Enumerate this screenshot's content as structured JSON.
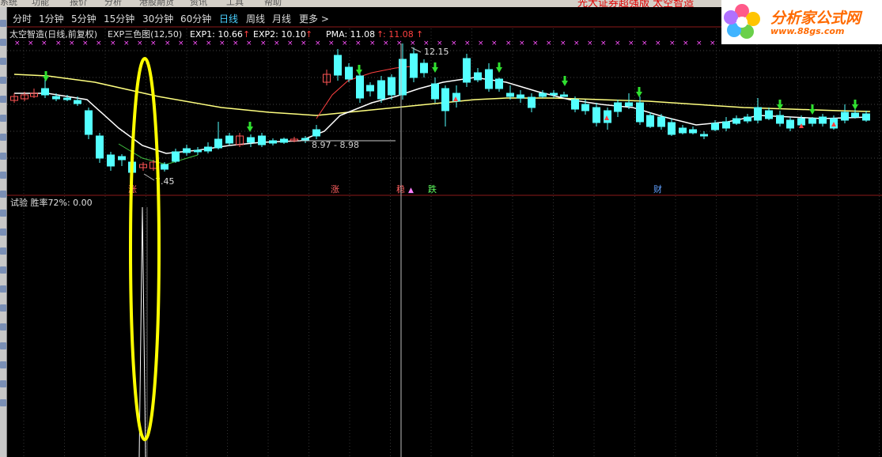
{
  "menu": {
    "items": [
      "系统",
      "功能",
      "报价",
      "分析",
      "港股期货",
      "资讯",
      "工具",
      "帮助"
    ],
    "title_red": "光大证券超强版  太空智造"
  },
  "periods": [
    {
      "label": "分时",
      "active": false
    },
    {
      "label": "1分钟",
      "active": false
    },
    {
      "label": "5分钟",
      "active": false
    },
    {
      "label": "15分钟",
      "active": false
    },
    {
      "label": "30分钟",
      "active": false
    },
    {
      "label": "60分钟",
      "active": false
    },
    {
      "label": "日线",
      "active": true
    },
    {
      "label": "周线",
      "active": false
    },
    {
      "label": "月线",
      "active": false
    },
    {
      "label": "更多 >",
      "active": false
    }
  ],
  "indicator": {
    "stock_name": "太空智造(日线,前复权)",
    "ind_name": "EXP三色图(12,50)",
    "exp1": "EXP1: 10.66",
    "exp2": "EXP2: 10.10",
    "pma": "PMA: 11.08",
    "pma2": ": 11.08"
  },
  "annotations": {
    "high_price": "12.15",
    "low_price": "7.45",
    "range_label": "8.97 - 8.98",
    "signals": [
      "涨",
      "稳",
      "跌",
      "财"
    ]
  },
  "lower_panel": {
    "title": "试验  胜率72%: 0.00"
  },
  "logo": {
    "text": "分析家公式网",
    "url": "www.88gs.com"
  },
  "colors": {
    "up": "#ff5555",
    "down": "#54ffff",
    "ma_white": "#ffffff",
    "ma_yellow": "#ffff80",
    "highlight_ellipse": "#ffff00",
    "active_period": "#4ad0ff",
    "grid": "#8b1a1a"
  }
}
